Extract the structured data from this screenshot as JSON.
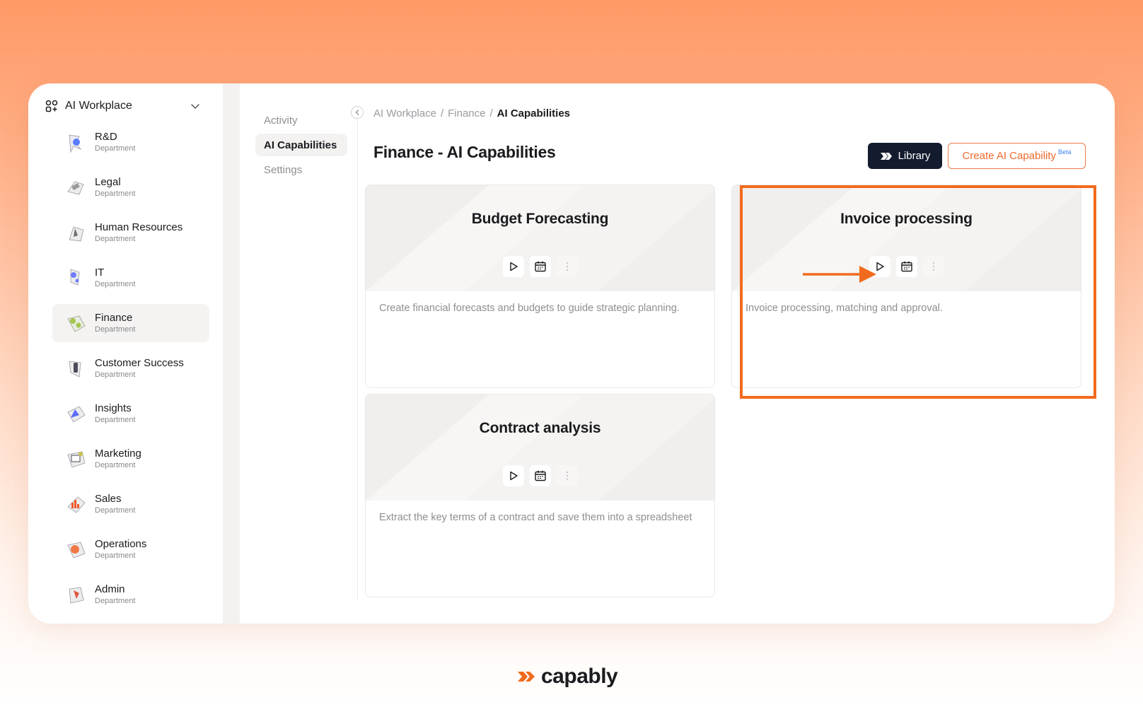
{
  "workspace": {
    "title": "AI Workplace",
    "icon": "workspace-icon"
  },
  "departments": [
    {
      "name": "R&D",
      "subtitle": "Department",
      "icon": "rnd-illustration",
      "color": "#5b7cff"
    },
    {
      "name": "Legal",
      "subtitle": "Department",
      "icon": "legal-illustration",
      "color": "#9a9a9a"
    },
    {
      "name": "Human Resources",
      "subtitle": "Department",
      "icon": "hr-illustration",
      "color": "#6d6d6d"
    },
    {
      "name": "IT",
      "subtitle": "Department",
      "icon": "it-illustration",
      "color": "#6f7cff"
    },
    {
      "name": "Finance",
      "subtitle": "Department",
      "icon": "finance-illustration",
      "color": "#a3c64b",
      "active": true
    },
    {
      "name": "Customer Success",
      "subtitle": "Department",
      "icon": "customer-success-illustration",
      "color": "#4b4b5a"
    },
    {
      "name": "Insights",
      "subtitle": "Department",
      "icon": "insights-illustration",
      "color": "#5b6cff"
    },
    {
      "name": "Marketing",
      "subtitle": "Department",
      "icon": "marketing-illustration",
      "color": "#c9c24b"
    },
    {
      "name": "Sales",
      "subtitle": "Department",
      "icon": "sales-illustration",
      "color": "#ef5a2c"
    },
    {
      "name": "Operations",
      "subtitle": "Department",
      "icon": "operations-illustration",
      "color": "#f07a45"
    },
    {
      "name": "Admin",
      "subtitle": "Department",
      "icon": "admin-illustration",
      "color": "#e0553a"
    }
  ],
  "subnav": {
    "items": [
      {
        "label": "Activity",
        "active": false
      },
      {
        "label": "AI Capabilities",
        "active": true
      },
      {
        "label": "Settings",
        "active": false
      }
    ]
  },
  "breadcrumb": {
    "items": [
      "AI Workplace",
      "/",
      "Finance",
      "/"
    ],
    "current": "AI Capabilities"
  },
  "page": {
    "title": "Finance - AI Capabilities"
  },
  "toolbar": {
    "library_label": "Library",
    "create_label": "Create AI Capability",
    "beta_label": "Beta"
  },
  "cards": [
    {
      "title": "Budget Forecasting",
      "description": "Create financial forecasts and budgets to guide strategic planning."
    },
    {
      "title": "Invoice processing",
      "description": "Invoice processing, matching and approval."
    },
    {
      "title": "Contract analysis",
      "description": "Extract the key terms of a contract and save them into a spreadsheet"
    }
  ],
  "brand": {
    "name": "capably"
  },
  "colors": {
    "accent": "#f26b1d",
    "dark_button": "#131b2e",
    "muted_text": "#8e8e93"
  }
}
